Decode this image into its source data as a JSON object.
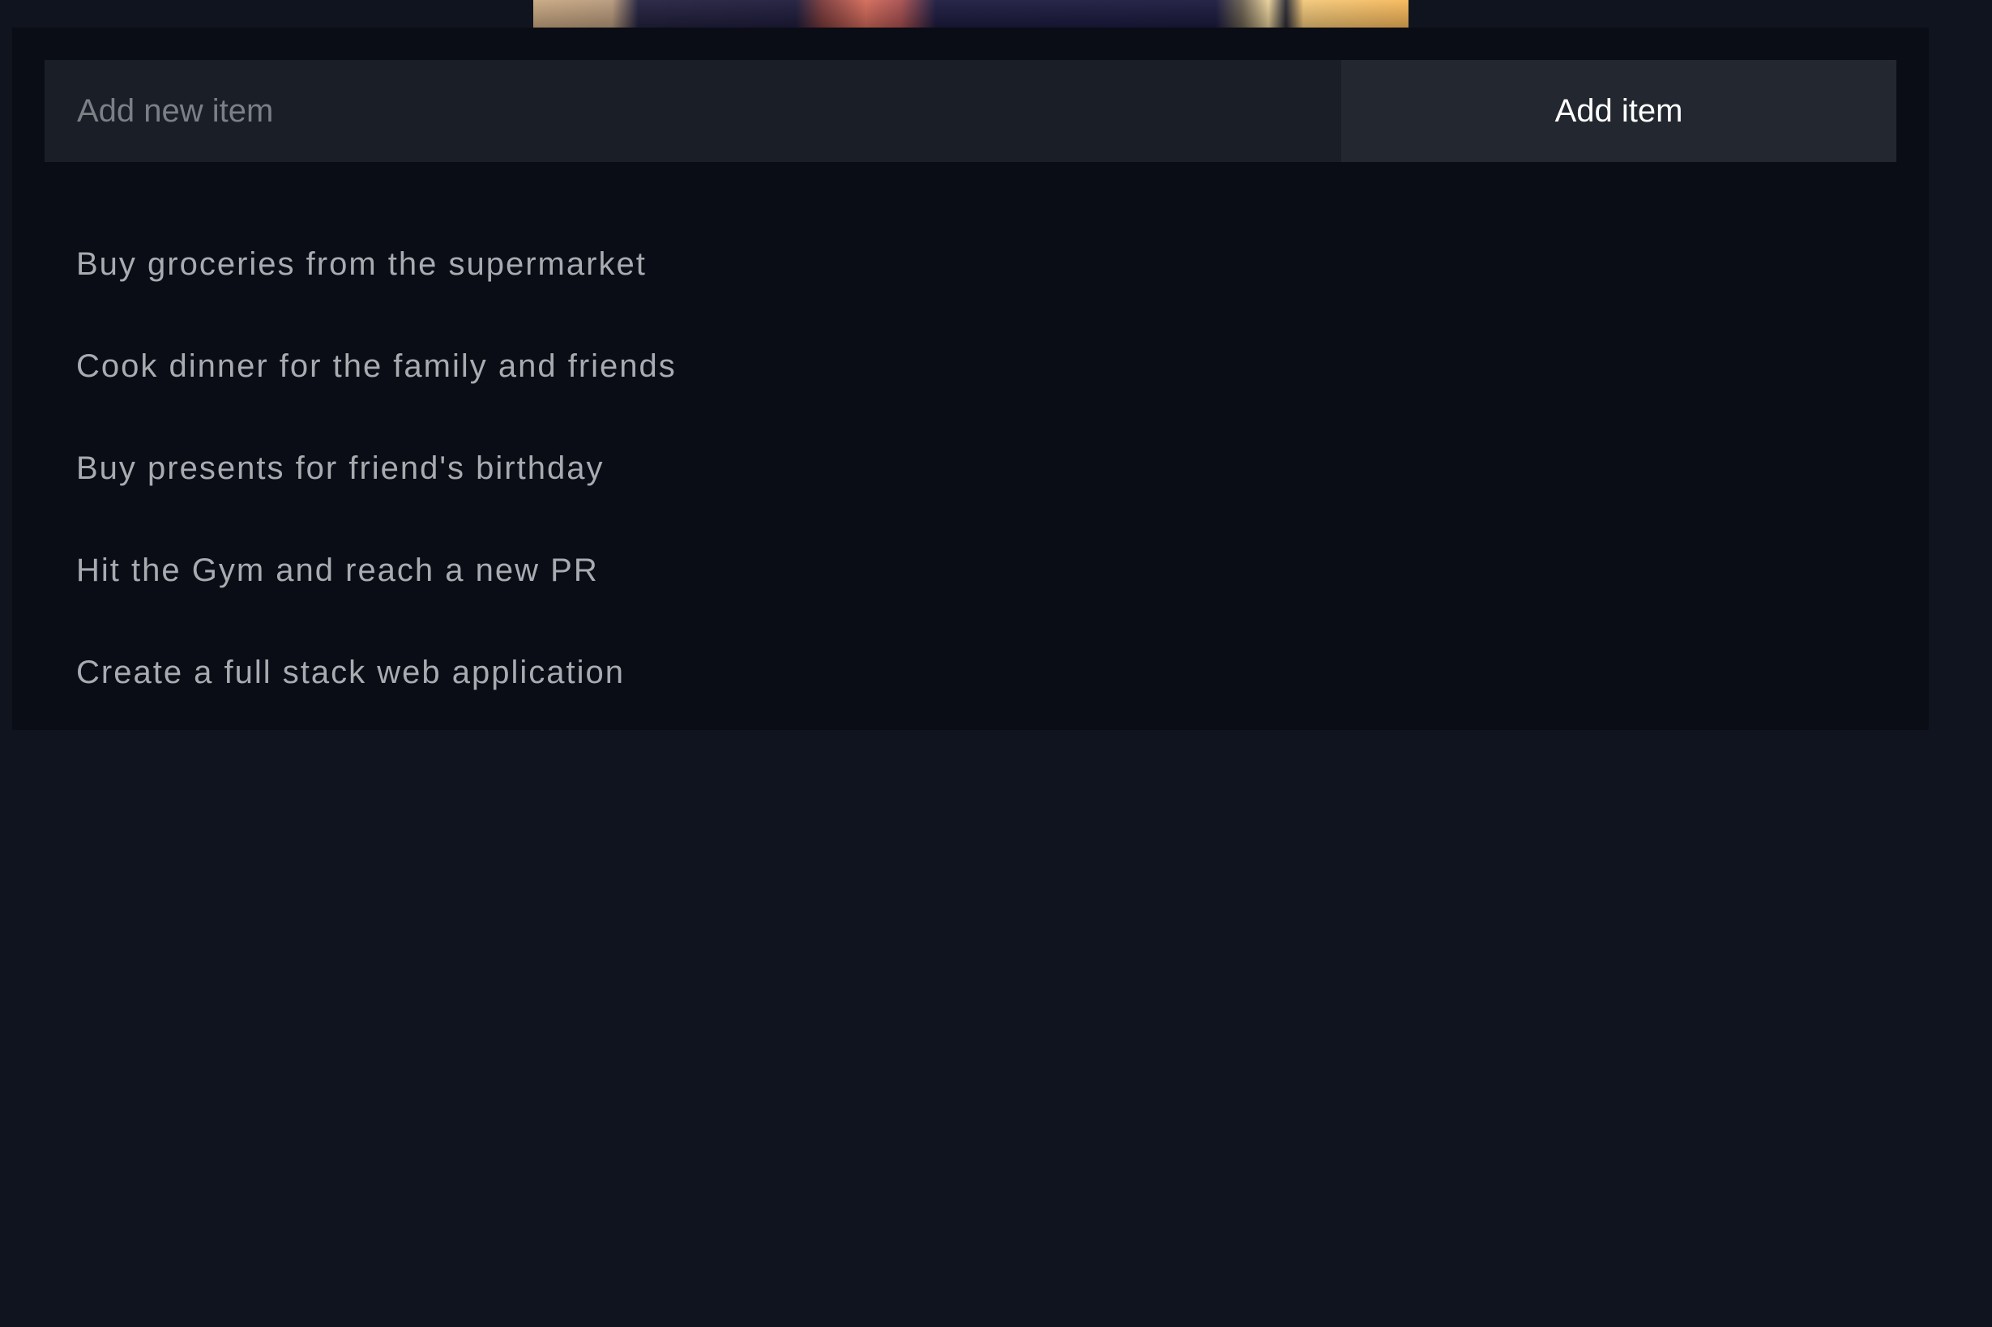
{
  "form": {
    "input_placeholder": "Add new item",
    "input_value": "",
    "add_button_label": "Add item"
  },
  "todo_list": {
    "items": [
      {
        "label": "Buy groceries from the supermarket"
      },
      {
        "label": "Cook dinner for the family and friends"
      },
      {
        "label": "Buy presents for friend's birthday"
      },
      {
        "label": "Hit the Gym and reach a new PR"
      },
      {
        "label": "Create a full stack web application"
      }
    ]
  },
  "colors": {
    "page_background": "#0f141e",
    "panel_background": "#0a0d15",
    "input_background": "#1a1e26",
    "button_background": "#23272f",
    "item_text": "#a8abb0",
    "button_text": "#ffffff"
  }
}
